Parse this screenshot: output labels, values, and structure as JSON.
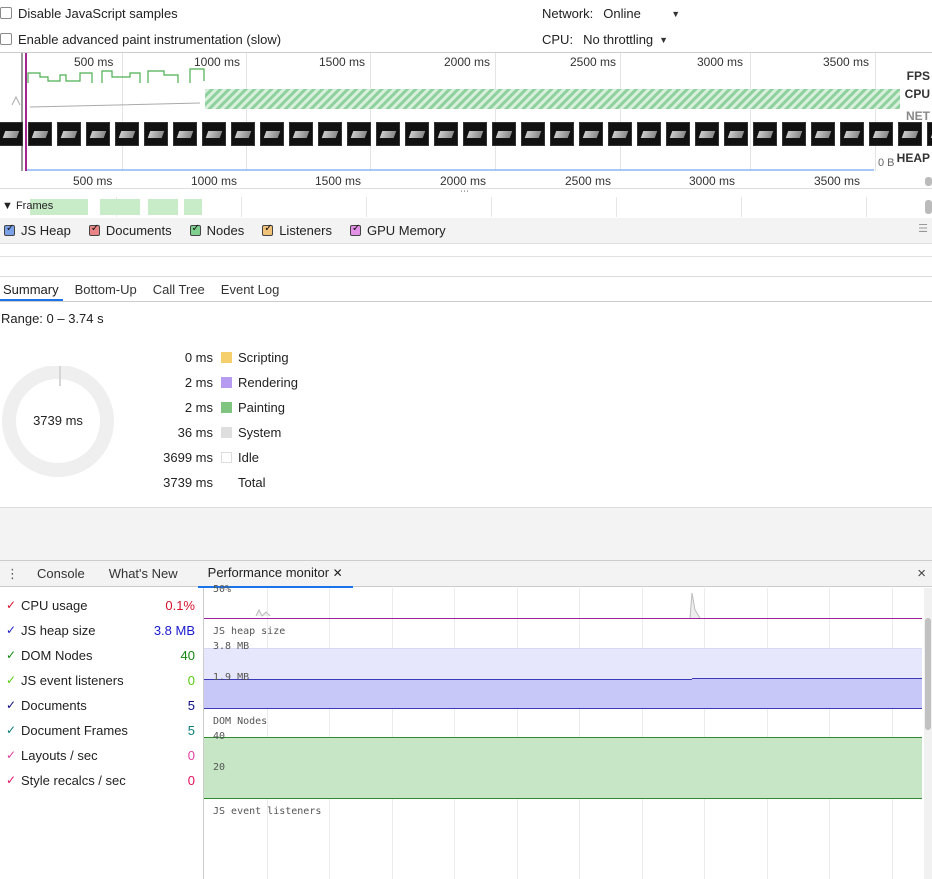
{
  "settings": {
    "disable_js_samples": "Disable JavaScript samples",
    "advanced_paint": "Enable advanced paint instrumentation (slow)",
    "network_label": "Network:",
    "network_value": "Online",
    "cpu_label": "CPU:",
    "cpu_value": "No throttling"
  },
  "overview": {
    "ticks": [
      "500 ms",
      "1000 ms",
      "1500 ms",
      "2000 ms",
      "2500 ms",
      "3000 ms",
      "3500 ms"
    ],
    "tracks": [
      "FPS",
      "CPU",
      "NET",
      "HEAP"
    ],
    "heap_value": "0 B",
    "colors": {
      "fps": "#4caf50",
      "cpu_stripe": "#8fd19e"
    }
  },
  "ruler": {
    "ticks": [
      "500 ms",
      "1000 ms",
      "1500 ms",
      "2000 ms",
      "2500 ms",
      "3000 ms",
      "3500 ms"
    ]
  },
  "frames_label": "Frames",
  "counters": [
    {
      "label": "JS Heap",
      "color": "#3367d6"
    },
    {
      "label": "Documents",
      "color": "#d55"
    },
    {
      "label": "Nodes",
      "color": "#33a853"
    },
    {
      "label": "Listeners",
      "color": "#e8a33d"
    },
    {
      "label": "GPU Memory",
      "color": "#c24fc8"
    }
  ],
  "tabs": [
    "Summary",
    "Bottom-Up",
    "Call Tree",
    "Event Log"
  ],
  "summary": {
    "range": "Range: 0 – 3.74 s",
    "total_center": "3739 ms",
    "rows": [
      {
        "value": "0 ms",
        "label": "Scripting",
        "color": "#f5cf6b"
      },
      {
        "value": "2 ms",
        "label": "Rendering",
        "color": "#b59cf1"
      },
      {
        "value": "2 ms",
        "label": "Painting",
        "color": "#7fc47f"
      },
      {
        "value": "36 ms",
        "label": "System",
        "color": "#dedede"
      },
      {
        "value": "3699 ms",
        "label": "Idle",
        "color": "#ffffff"
      },
      {
        "value": "3739 ms",
        "label": "Total",
        "color": ""
      }
    ]
  },
  "drawer": {
    "tabs": [
      "Console",
      "What's New",
      "Performance monitor"
    ],
    "close_glyph": "×"
  },
  "metrics": [
    {
      "name": "CPU usage",
      "value": "0.1%",
      "color": "#d6122d"
    },
    {
      "name": "JS heap size",
      "value": "3.8 MB",
      "color": "#1a1acc"
    },
    {
      "name": "DOM Nodes",
      "value": "40",
      "color": "#118811"
    },
    {
      "name": "JS event listeners",
      "value": "0",
      "color": "#55cc11"
    },
    {
      "name": "Documents",
      "value": "5",
      "color": "#0a0a80"
    },
    {
      "name": "Document Frames",
      "value": "5",
      "color": "#0a7a7a"
    },
    {
      "name": "Layouts / sec",
      "value": "0",
      "color": "#e040a0"
    },
    {
      "name": "Style recalcs / sec",
      "value": "0",
      "color": "#e01060"
    }
  ],
  "graph": {
    "cpu_top": "50%",
    "heap_title": "JS heap size",
    "heap_max": "3.8 MB",
    "heap_mid": "1.9 MB",
    "nodes_title": "DOM Nodes",
    "nodes_max": "40",
    "nodes_mid": "20",
    "listeners_title": "JS event listeners"
  }
}
